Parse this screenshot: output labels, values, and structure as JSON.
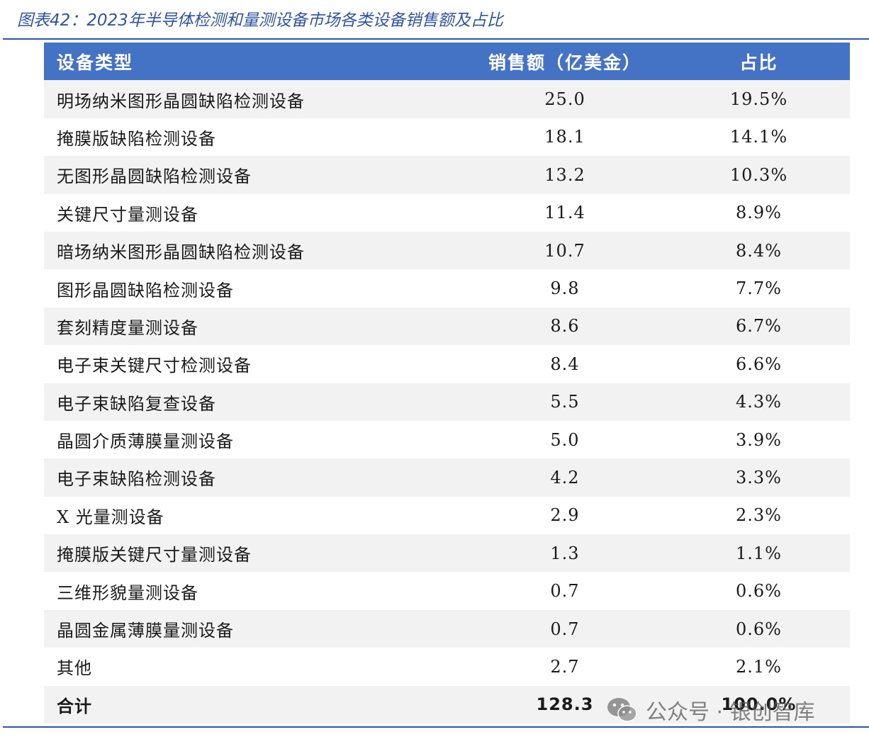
{
  "caption": "图表42：2023年半导体检测和量测设备市场各类设备销售额及占比",
  "table": {
    "headers": {
      "type": "设备类型",
      "sales": "销售额（亿美金）",
      "share": "占比"
    },
    "rows": [
      {
        "type": "明场纳米图形晶圆缺陷检测设备",
        "sales": "25.0",
        "share": "19.5%"
      },
      {
        "type": "掩膜版缺陷检测设备",
        "sales": "18.1",
        "share": "14.1%"
      },
      {
        "type": "无图形晶圆缺陷检测设备",
        "sales": "13.2",
        "share": "10.3%"
      },
      {
        "type": "关键尺寸量测设备",
        "sales": "11.4",
        "share": "8.9%"
      },
      {
        "type": "暗场纳米图形晶圆缺陷检测设备",
        "sales": "10.7",
        "share": "8.4%"
      },
      {
        "type": "图形晶圆缺陷检测设备",
        "sales": "9.8",
        "share": "7.7%"
      },
      {
        "type": "套刻精度量测设备",
        "sales": "8.6",
        "share": "6.7%"
      },
      {
        "type": "电子束关键尺寸检测设备",
        "sales": "8.4",
        "share": "6.6%"
      },
      {
        "type": "电子束缺陷复查设备",
        "sales": "5.5",
        "share": "4.3%"
      },
      {
        "type": "晶圆介质薄膜量测设备",
        "sales": "5.0",
        "share": "3.9%"
      },
      {
        "type": "电子束缺陷检测设备",
        "sales": "4.2",
        "share": "3.3%"
      },
      {
        "type": "X 光量测设备",
        "sales": "2.9",
        "share": "2.3%"
      },
      {
        "type": "掩膜版关键尺寸量测设备",
        "sales": "1.3",
        "share": "1.1%"
      },
      {
        "type": "三维形貌量测设备",
        "sales": "0.7",
        "share": "0.6%"
      },
      {
        "type": "晶圆金属薄膜量测设备",
        "sales": "0.7",
        "share": "0.6%"
      },
      {
        "type": "其他",
        "sales": "2.7",
        "share": "2.1%"
      }
    ],
    "total": {
      "type": "合计",
      "sales": "128.3",
      "share": "100.0%"
    }
  },
  "watermark": {
    "text": "公众号 · 银创智库",
    "icon": "wechat-icon"
  },
  "colors": {
    "header_bg": "#4472c4",
    "caption": "#2f54a3",
    "row_shade": "#f2f2f2"
  }
}
